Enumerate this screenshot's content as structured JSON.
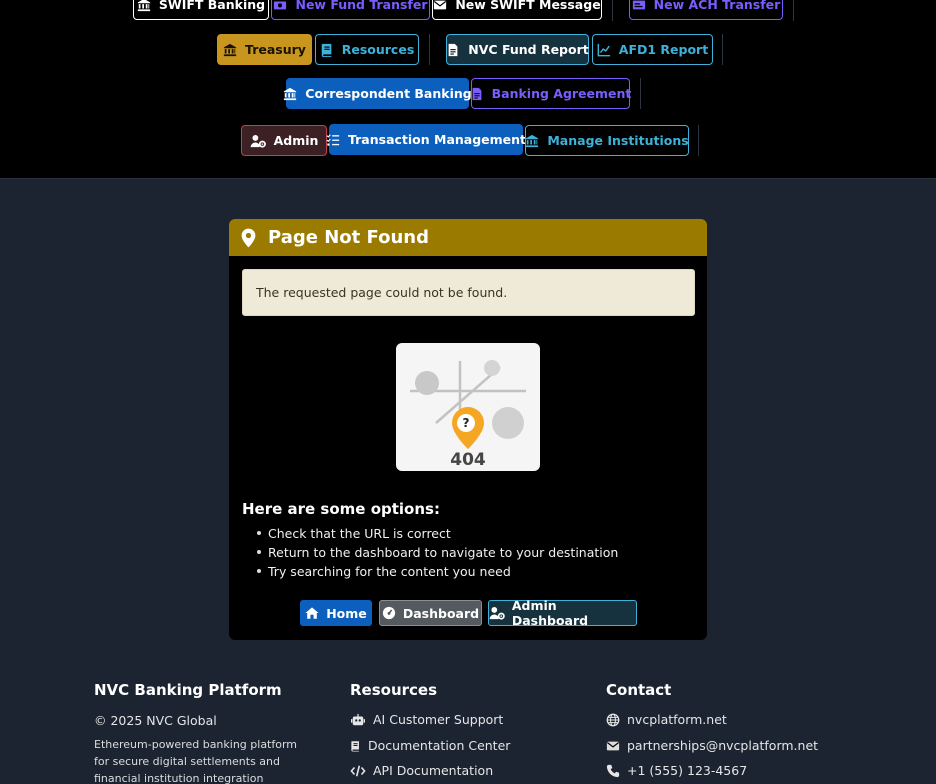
{
  "nav": {
    "row1": {
      "swift_banking": "SWIFT Banking",
      "new_fund_transfer": "New Fund Transfer",
      "new_swift_message": "New SWIFT Message",
      "new_ach_transfer": "New ACH Transfer"
    },
    "row2": {
      "treasury": "Treasury",
      "resources": "Resources",
      "nvc_fund_report": "NVC Fund Report",
      "afd1_report": "AFD1 Report"
    },
    "row3": {
      "correspondent_banking": "Correspondent Banking",
      "banking_agreement": "Banking Agreement"
    },
    "row4": {
      "admin": "Admin",
      "transaction_management": "Transaction Management",
      "manage_institutions": "Manage Institutions"
    }
  },
  "card": {
    "title": "Page Not Found",
    "alert": "The requested page could not be found.",
    "illustration": {
      "pin_symbol": "?",
      "code": "404"
    },
    "options_title": "Here are some options:",
    "options": [
      "Check that the URL is correct",
      "Return to the dashboard to navigate to your destination",
      "Try searching for the content you need"
    ],
    "buttons": {
      "home": "Home",
      "dashboard": "Dashboard",
      "admin_dashboard": "Admin Dashboard"
    }
  },
  "footer": {
    "brand": {
      "title": "NVC Banking Platform",
      "copyright": "© 2025 NVC Global",
      "description": "Ethereum-powered banking platform for secure digital settlements and financial institution integration"
    },
    "resources": {
      "title": "Resources",
      "items": [
        "AI Customer Support",
        "Documentation Center",
        "API Documentation"
      ]
    },
    "contact": {
      "title": "Contact",
      "items": [
        "nvcplatform.net",
        "partnerships@nvcplatform.net",
        "+1 (555) 123-4567"
      ]
    }
  },
  "colors": {
    "header_gold": "#9a7b00",
    "treasury_gold": "#c8961e",
    "primary_blue": "#0d5fbd",
    "info_cyan": "#3fb1d8",
    "purple": "#7a5cff",
    "admin_red": "#c0404b"
  },
  "icons": {
    "swift_banking": "bank-icon",
    "new_fund_transfer": "money-bill-icon",
    "new_swift_message": "envelope-icon",
    "new_ach_transfer": "money-check-icon",
    "treasury": "bank-icon",
    "resources": "book-icon",
    "nvc_fund_report": "file-icon",
    "afd1_report": "line-chart-icon",
    "correspondent_banking": "bank-icon",
    "banking_agreement": "file-icon",
    "admin": "user-gear-icon",
    "transaction_management": "list-check-icon",
    "manage_institutions": "bank-icon",
    "page_title": "map-pin-icon",
    "home": "home-icon",
    "dashboard": "gauge-icon",
    "admin_dashboard": "user-gear-icon",
    "ai_support": "robot-icon",
    "docs": "book-icon",
    "api": "code-icon",
    "web": "globe-icon",
    "email": "envelope-icon",
    "phone": "phone-icon"
  }
}
